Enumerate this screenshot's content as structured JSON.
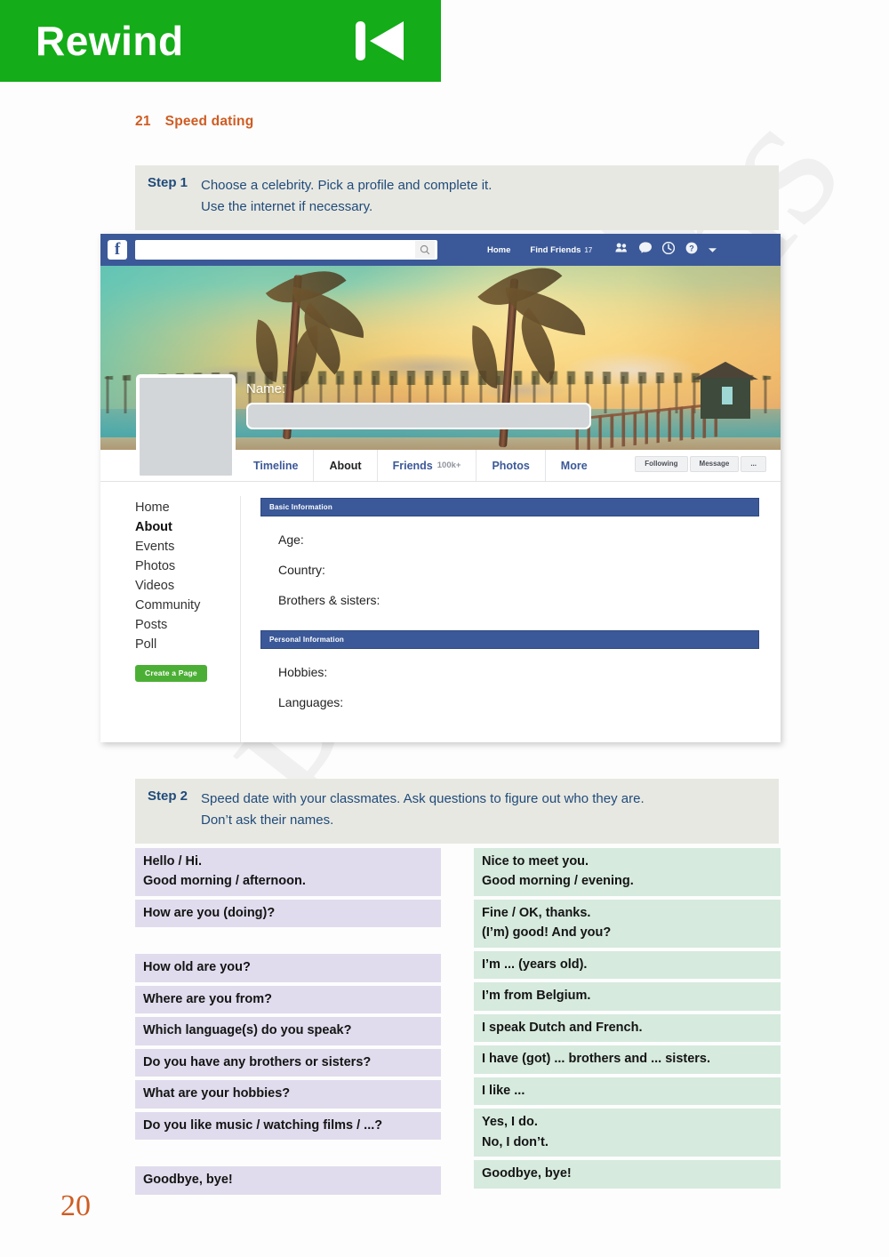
{
  "banner": {
    "title": "Rewind",
    "icon": "rewind-icon"
  },
  "exercise": {
    "number": "21",
    "title": "Speed dating"
  },
  "steps": [
    {
      "label": "Step 1",
      "line1": "Choose a celebrity. Pick a profile and complete it.",
      "line2": "Use the internet if necessary."
    },
    {
      "label": "Step 2",
      "line1": "Speed date with your classmates. Ask questions to figure out who they are.",
      "line2": "Don’t ask their names."
    }
  ],
  "facebook": {
    "logo_letter": "f",
    "search_placeholder": "",
    "search_value": "",
    "nav": [
      {
        "label": "Home",
        "badge": ""
      },
      {
        "label": "Find Friends",
        "badge": "17"
      }
    ],
    "topbar_icons": [
      "friend-requests-icon",
      "messages-icon",
      "notifications-icon",
      "help-icon",
      "chevron-down-icon"
    ],
    "cover": {
      "alt": "tropical beach sunset with palm trees"
    },
    "name_label": "Name:",
    "name_value": "",
    "tabs": [
      {
        "label": "Timeline",
        "count": "",
        "active": false
      },
      {
        "label": "About",
        "count": "",
        "active": true
      },
      {
        "label": "Friends",
        "count": "100k+",
        "active": false
      },
      {
        "label": "Photos",
        "count": "",
        "active": false
      },
      {
        "label": "More",
        "count": "",
        "active": false
      }
    ],
    "actions": [
      "Following",
      "Message",
      "..."
    ],
    "sidebar": [
      {
        "label": "Home",
        "active": false
      },
      {
        "label": "About",
        "active": true
      },
      {
        "label": "Events",
        "active": false
      },
      {
        "label": "Photos",
        "active": false
      },
      {
        "label": "Videos",
        "active": false
      },
      {
        "label": "Community",
        "active": false
      },
      {
        "label": "Posts",
        "active": false
      },
      {
        "label": "Poll",
        "active": false
      }
    ],
    "create_page_button": "Create a Page",
    "sections": [
      {
        "heading": "Basic Information",
        "fields": [
          "Age:",
          "Country:",
          "Brothers & sisters:"
        ]
      },
      {
        "heading": "Personal Information",
        "fields": [
          "Hobbies:",
          "Languages:"
        ]
      }
    ]
  },
  "phrases": {
    "left": [
      "Hello / Hi.\nGood morning / afternoon.",
      "How are you (doing)?",
      "",
      "How old are you?",
      "Where are you from?",
      "Which language(s) do you speak?",
      "Do you have any brothers or sisters?",
      "What are your hobbies?",
      "Do you like music / watching films / ...?",
      "",
      "Goodbye, bye!"
    ],
    "right": [
      "Nice to meet you.\nGood morning / evening.",
      "Fine / OK, thanks.\n(I’m) good! And you?",
      "I’m ... (years old).",
      "I’m from Belgium.",
      "I speak Dutch and French.",
      "I have (got) ... brothers and ... sisters.",
      "I like ...",
      "Yes, I do.\nNo, I don’t.",
      "Goodbye, bye!"
    ]
  },
  "page_number": "20",
  "colors": {
    "banner_green": "#14ac18",
    "heading_orange": "#cf5c22",
    "step_blue": "#1f4b7a",
    "step_bg": "#e8e8e2",
    "fb_blue": "#3b5998",
    "left_box": "#e0dced",
    "right_box": "#d6eade"
  }
}
